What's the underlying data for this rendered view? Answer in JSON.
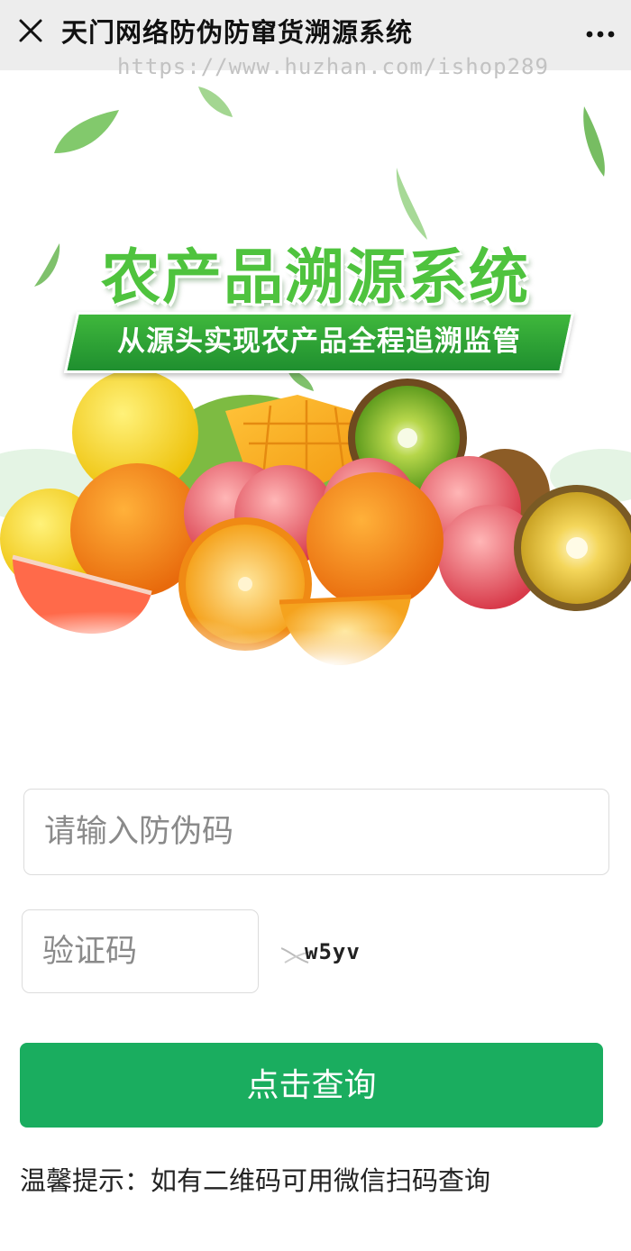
{
  "header": {
    "title": "天门网络防伪防窜货溯源系统",
    "close_icon": "close-icon",
    "more_icon": "more-dots-icon"
  },
  "watermark": "https://www.huzhan.com/ishop289",
  "banner": {
    "headline": "农产品溯源系统",
    "subtitle": "从源头实现农产品全程追溯监管"
  },
  "form": {
    "code_placeholder": "请输入防伪码",
    "captcha_placeholder": "验证码",
    "captcha_text": "w5yv",
    "submit_label": "点击查询"
  },
  "tip": "温馨提示：如有二维码可用微信扫码查询",
  "colors": {
    "accent": "#1aad5f",
    "headline": "#4fc33e",
    "topbar": "#ededed"
  }
}
